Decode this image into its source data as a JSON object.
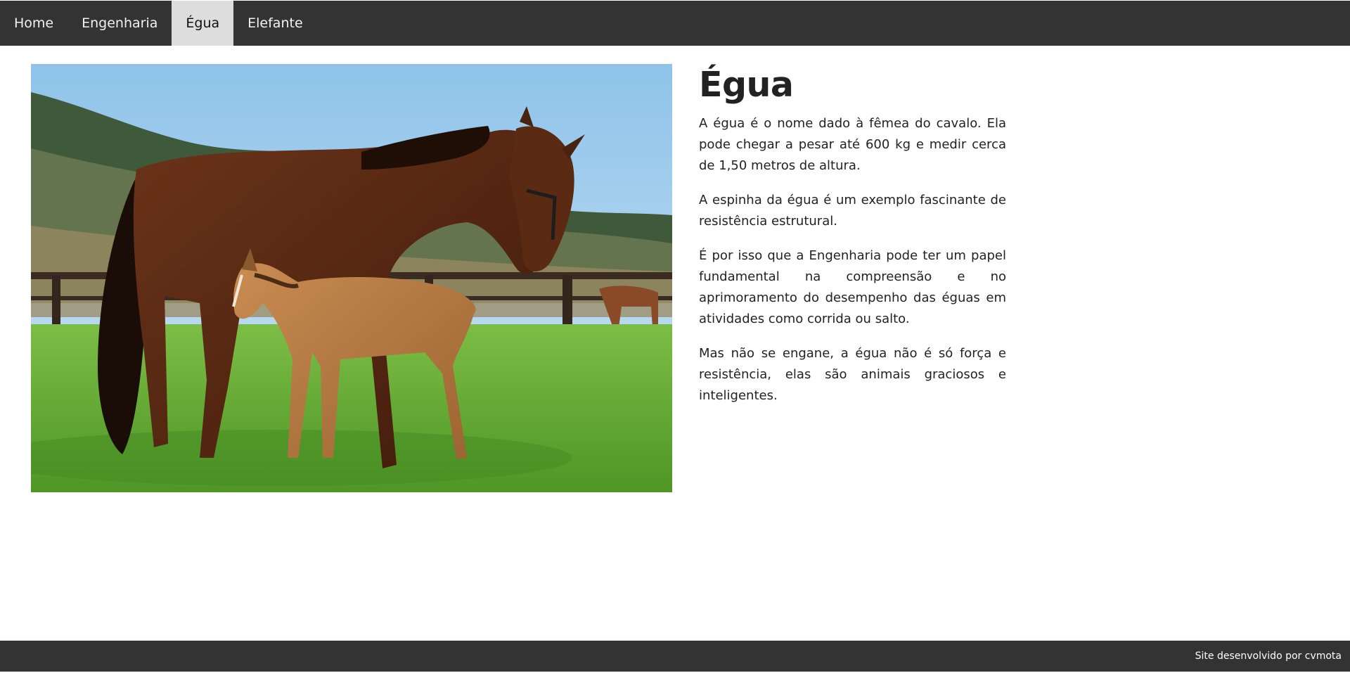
{
  "nav": {
    "items": [
      {
        "label": "Home"
      },
      {
        "label": "Engenharia"
      },
      {
        "label": "Égua"
      },
      {
        "label": "Elefante"
      }
    ],
    "active": "Égua"
  },
  "image": {
    "subject": "mare and foal in a green pasture",
    "colors": {
      "sky": "#9cc9ec",
      "grass": "#5fa531",
      "mare": "#5a2a14",
      "foal": "#b97c45"
    }
  },
  "article": {
    "title": "Égua",
    "paragraphs": [
      "A égua é o nome dado à fêmea do cavalo. Ela pode chegar a pesar até 600 kg e medir cerca de 1,50 metros de altura.",
      "A espinha da égua é um exemplo fascinante de resistência estrutural.",
      "É por isso que a Engenharia pode ter um papel fundamental na compreensão e no aprimoramento do desempenho das éguas em atividades como corrida ou salto.",
      "Mas não se engane, a égua não é só força e resistência, elas são animais graciosos e inteligentes."
    ]
  },
  "footer": {
    "credit": "Site desenvolvido por cvmota"
  },
  "theme": {
    "nav_bg": "#333333",
    "nav_active_bg": "#dddddd",
    "footer_bg": "#333333"
  }
}
